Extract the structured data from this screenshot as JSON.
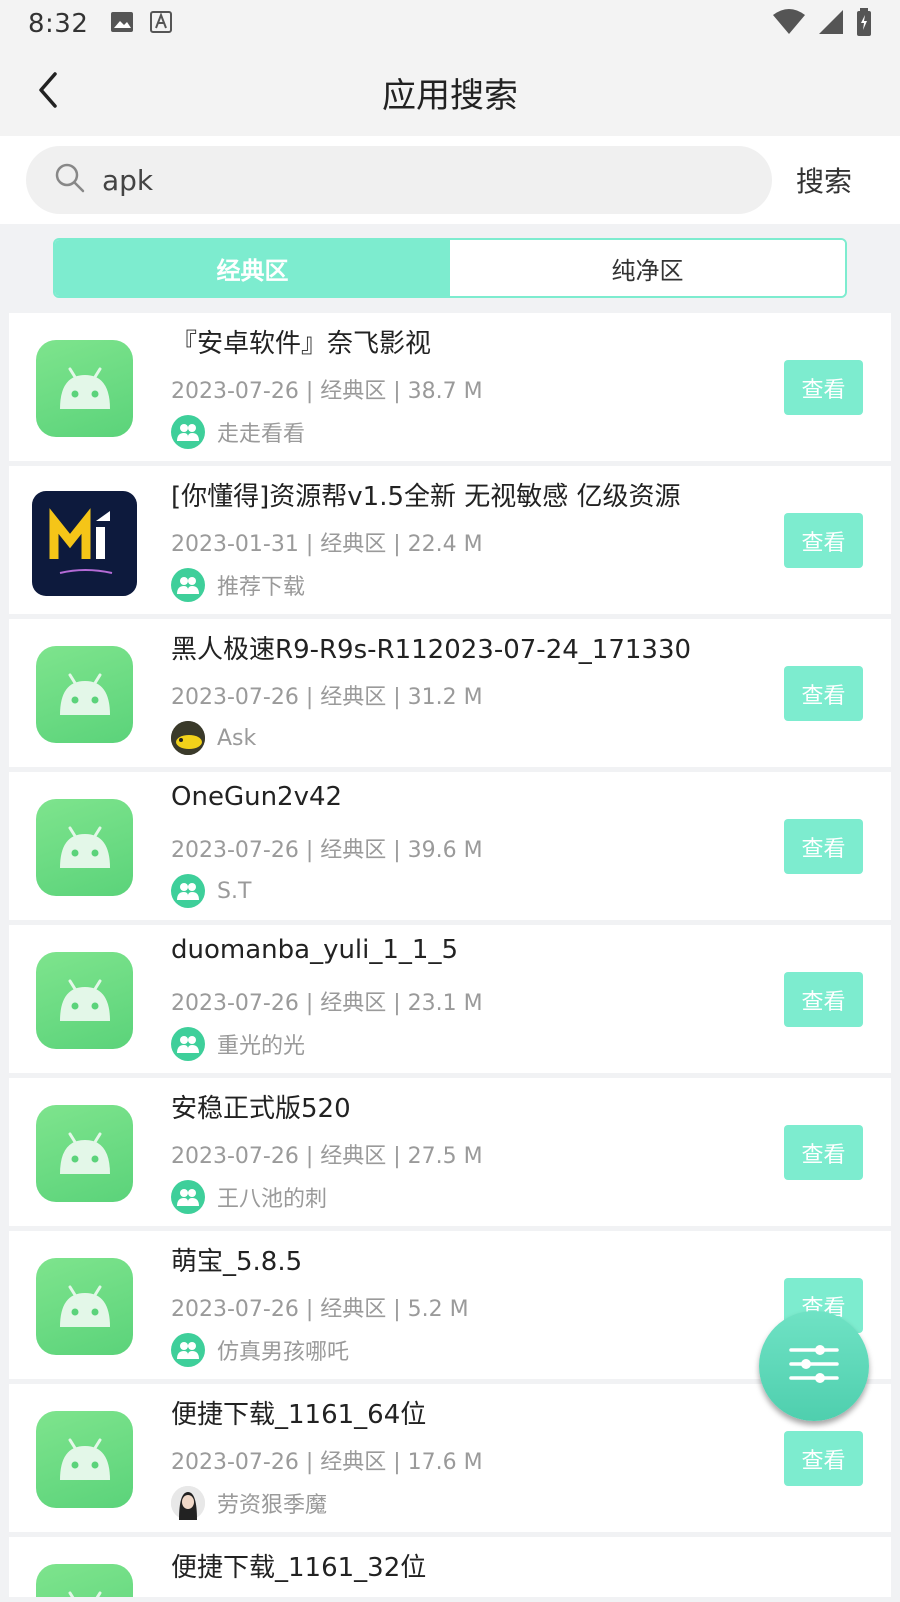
{
  "status": {
    "time": "8:32"
  },
  "appbar": {
    "title": "应用搜索"
  },
  "search": {
    "value": "apk",
    "button": "搜索"
  },
  "tabs": [
    {
      "label": "经典区",
      "active": true
    },
    {
      "label": "纯净区",
      "active": false
    }
  ],
  "list": [
    {
      "title": "『安卓软件』奈飞影视",
      "meta": "2023-07-26 | 经典区 | 38.7 M",
      "user": "走走看看",
      "icon": "android-icon",
      "button": "查看"
    },
    {
      "title": "[你懂得]资源帮v1.5全新 无视敏感 亿级资源",
      "meta": "2023-01-31 | 经典区 | 22.4 M",
      "user": "推荐下载",
      "icon": "mi-logo-icon",
      "button": "查看"
    },
    {
      "title": "黑人极速R9-R9s-R112023-07-24_171330",
      "meta": "2023-07-26 | 经典区 | 31.2 M",
      "user": "Ask",
      "icon": "android-icon",
      "button": "查看"
    },
    {
      "title": "OneGun2v42",
      "meta": "2023-07-26 | 经典区 | 39.6 M",
      "user": "S.T",
      "icon": "android-icon",
      "button": "查看"
    },
    {
      "title": "duomanba_yuli_1_1_5",
      "meta": "2023-07-26 | 经典区 | 23.1 M",
      "user": "重光的光",
      "icon": "android-icon",
      "button": "查看"
    },
    {
      "title": "安稳正式版520",
      "meta": "2023-07-26 | 经典区 | 27.5 M",
      "user": "王八池的刺",
      "icon": "android-icon",
      "button": "查看"
    },
    {
      "title": "萌宝_5.8.5",
      "meta": "2023-07-26 | 经典区 | 5.2 M",
      "user": "仿真男孩哪吒",
      "icon": "android-icon",
      "button": "查看"
    },
    {
      "title": "便捷下载_1161_64位",
      "meta": "2023-07-26 | 经典区 | 17.6 M",
      "user": "劳资狠季魔",
      "icon": "android-icon",
      "button": "查看"
    },
    {
      "title": "便捷下载_1161_32位"
    }
  ],
  "colors": {
    "accent": "#7deccf",
    "fab": "#4fcfae",
    "android": "#5bd37a"
  }
}
